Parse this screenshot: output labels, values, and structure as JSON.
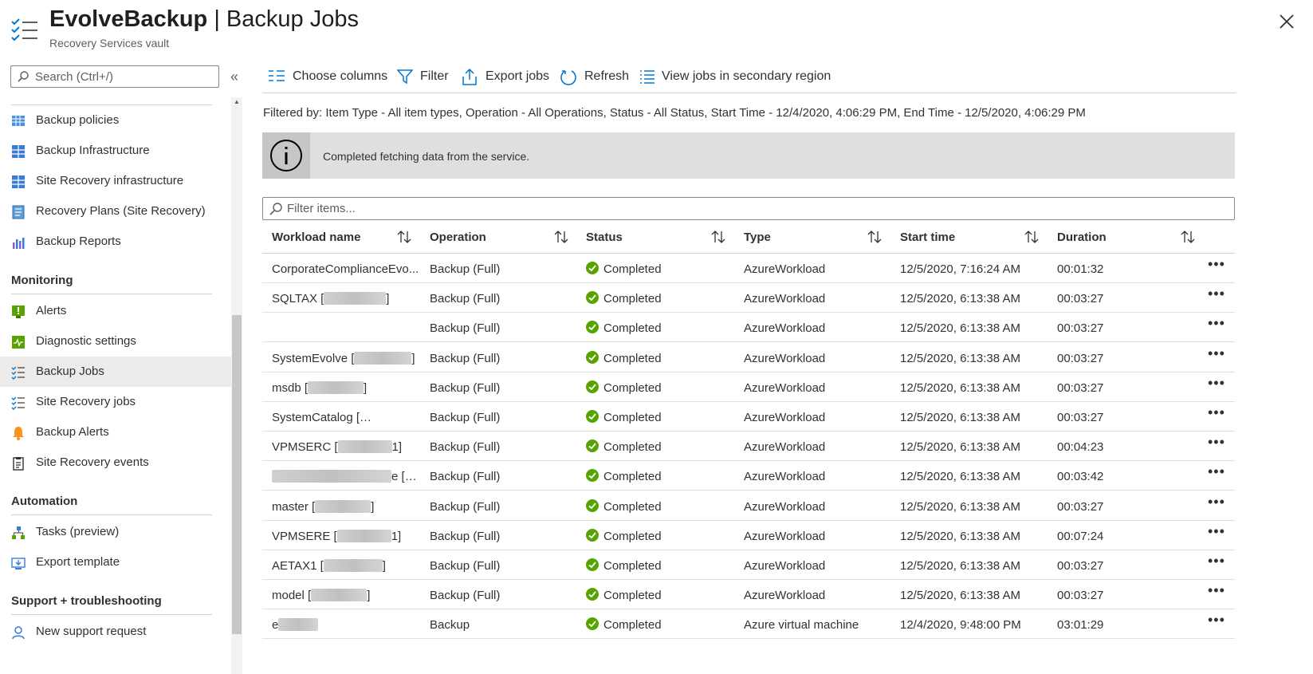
{
  "header": {
    "vault_name": "EvolveBackup",
    "page_name": "Backup Jobs",
    "subtitle": "Recovery Services vault"
  },
  "sidebar": {
    "search_placeholder": "Search (Ctrl+/)",
    "items": [
      {
        "label": "Backup policies",
        "icon": "policy-table-icon"
      },
      {
        "label": "Backup Infrastructure",
        "icon": "infrastructure-grid-icon"
      },
      {
        "label": "Site Recovery infrastructure",
        "icon": "infrastructure-grid-icon"
      },
      {
        "label": "Recovery Plans (Site Recovery)",
        "icon": "recovery-plan-icon"
      },
      {
        "label": "Backup Reports",
        "icon": "bar-chart-icon"
      }
    ],
    "monitoring": {
      "title": "Monitoring",
      "items": [
        {
          "label": "Alerts",
          "icon": "alert-icon"
        },
        {
          "label": "Diagnostic settings",
          "icon": "diagnostic-icon"
        },
        {
          "label": "Backup Jobs",
          "icon": "jobs-list-icon",
          "active": true
        },
        {
          "label": "Site Recovery jobs",
          "icon": "jobs-list-icon"
        },
        {
          "label": "Backup Alerts",
          "icon": "bell-icon"
        },
        {
          "label": "Site Recovery events",
          "icon": "clipboard-icon"
        }
      ]
    },
    "automation": {
      "title": "Automation",
      "items": [
        {
          "label": "Tasks (preview)",
          "icon": "tasks-icon"
        },
        {
          "label": "Export template",
          "icon": "export-template-icon"
        }
      ]
    },
    "support": {
      "title": "Support + troubleshooting",
      "items": [
        {
          "label": "New support request",
          "icon": "support-person-icon"
        }
      ]
    }
  },
  "toolbar": {
    "choose_columns": "Choose columns",
    "filter": "Filter",
    "export_jobs": "Export jobs",
    "refresh": "Refresh",
    "secondary_region": "View jobs in secondary region"
  },
  "filtered_by": "Filtered by: Item Type - All item types, Operation - All Operations, Status - All Status, Start Time - 12/4/2020, 4:06:29 PM, End Time - 12/5/2020, 4:06:29 PM",
  "info_message": "Completed fetching data from the service.",
  "filter_placeholder": "Filter items...",
  "table": {
    "columns": [
      "Workload name",
      "Operation",
      "Status",
      "Type",
      "Start time",
      "Duration"
    ],
    "rows": [
      {
        "name": "CorporateComplianceEvo...",
        "operation": "Backup (Full)",
        "status": "Completed",
        "type": "AzureWorkload",
        "start": "12/5/2020, 7:16:24 AM",
        "duration": "00:01:32"
      },
      {
        "name": "SQLTAX [",
        "name_suffix": "]",
        "operation": "Backup (Full)",
        "status": "Completed",
        "type": "AzureWorkload",
        "start": "12/5/2020, 6:13:38 AM",
        "duration": "00:03:27"
      },
      {
        "name": "",
        "name_suffix": "...",
        "operation": "Backup (Full)",
        "status": "Completed",
        "type": "AzureWorkload",
        "start": "12/5/2020, 6:13:38 AM",
        "duration": "00:03:27"
      },
      {
        "name": "SystemEvolve [",
        "name_suffix": "]",
        "operation": "Backup (Full)",
        "status": "Completed",
        "type": "AzureWorkload",
        "start": "12/5/2020, 6:13:38 AM",
        "duration": "00:03:27"
      },
      {
        "name": "msdb [",
        "name_suffix": "]",
        "operation": "Backup (Full)",
        "status": "Completed",
        "type": "AzureWorkload",
        "start": "12/5/2020, 6:13:38 AM",
        "duration": "00:03:27"
      },
      {
        "name": "SystemCatalog [",
        "name_suffix": "...",
        "operation": "Backup (Full)",
        "status": "Completed",
        "type": "AzureWorkload",
        "start": "12/5/2020, 6:13:38 AM",
        "duration": "00:03:27"
      },
      {
        "name": "VPMSERC [",
        "name_suffix": "1]",
        "operation": "Backup (Full)",
        "status": "Completed",
        "type": "AzureWorkload",
        "start": "12/5/2020, 6:13:38 AM",
        "duration": "00:04:23"
      },
      {
        "name": "",
        "name_suffix": "e [E...",
        "operation": "Backup (Full)",
        "status": "Completed",
        "type": "AzureWorkload",
        "start": "12/5/2020, 6:13:38 AM",
        "duration": "00:03:42"
      },
      {
        "name": "master [",
        "name_suffix": "]",
        "operation": "Backup (Full)",
        "status": "Completed",
        "type": "AzureWorkload",
        "start": "12/5/2020, 6:13:38 AM",
        "duration": "00:03:27"
      },
      {
        "name": "VPMSERE [",
        "name_suffix": "1]",
        "operation": "Backup (Full)",
        "status": "Completed",
        "type": "AzureWorkload",
        "start": "12/5/2020, 6:13:38 AM",
        "duration": "00:07:24"
      },
      {
        "name": "AETAX1 [",
        "name_suffix": "]",
        "operation": "Backup (Full)",
        "status": "Completed",
        "type": "AzureWorkload",
        "start": "12/5/2020, 6:13:38 AM",
        "duration": "00:03:27"
      },
      {
        "name": "model [",
        "name_suffix": "]",
        "operation": "Backup (Full)",
        "status": "Completed",
        "type": "AzureWorkload",
        "start": "12/5/2020, 6:13:38 AM",
        "duration": "00:03:27"
      },
      {
        "name": "e",
        "name_suffix": "",
        "operation": "Backup",
        "status": "Completed",
        "type": "Azure virtual machine",
        "start": "12/4/2020, 9:48:00 PM",
        "duration": "03:01:29"
      }
    ]
  },
  "colors": {
    "accent": "#0078d4",
    "success": "#57a300",
    "active_bg": "#edebe9",
    "info_bg": "#e1dfdd"
  }
}
